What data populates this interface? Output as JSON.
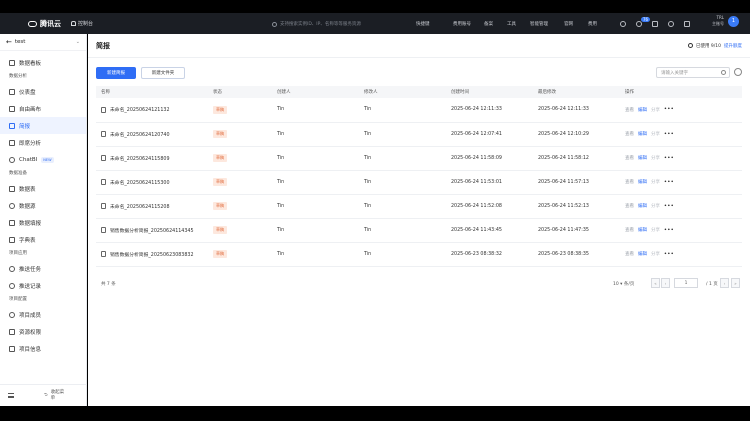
{
  "app": {
    "brand": "腾讯云",
    "workspace": "控制台",
    "search_placeholder": "支持搜索实例ID、IP、名称等等服务资源",
    "nav": [
      "快捷键",
      "费用账号",
      "备案",
      "工具",
      "智能管理",
      "官网",
      "费用"
    ],
    "notif_count": "76",
    "user_line1": "TRL",
    "user_line2": "主账号",
    "avatar": "1"
  },
  "sidebar": {
    "back_label": "test",
    "items_top": [
      {
        "label": "数据看板"
      }
    ],
    "groups": [
      {
        "title": "数据分析",
        "items": [
          {
            "label": "仪表盘",
            "active": false
          },
          {
            "label": "自由画布",
            "active": false
          },
          {
            "label": "简报",
            "active": true
          },
          {
            "label": "即席分析",
            "active": false
          },
          {
            "label": "ChatBI",
            "tag": "NEW",
            "active": false
          }
        ]
      },
      {
        "title": "数据准备",
        "items": [
          {
            "label": "数据表",
            "active": false
          },
          {
            "label": "数据源",
            "active": false
          },
          {
            "label": "数据填报",
            "active": false
          },
          {
            "label": "字典表",
            "active": false
          }
        ]
      },
      {
        "title": "项目应用",
        "items": [
          {
            "label": "推送任务",
            "active": false
          },
          {
            "label": "推送记录",
            "active": false
          }
        ]
      },
      {
        "title": "项目配置",
        "items": [
          {
            "label": "项目成员",
            "active": false
          },
          {
            "label": "资源权限",
            "active": false
          },
          {
            "label": "项目信息",
            "active": false
          }
        ]
      }
    ],
    "collapse_label": "收起菜单"
  },
  "main": {
    "title": "简报",
    "usage_text": "已使用 9/10",
    "usage_link": "提升额度",
    "new_button": "新建简报",
    "new_folder_button": "新建文件夹",
    "keyword_placeholder": "请输入关键字",
    "columns": [
      "名称",
      "状态",
      "创建人",
      "修改人",
      "创建时间",
      "最后修改",
      "操作"
    ],
    "rows": [
      {
        "name": "未命名_20250624121132",
        "status": "草稿",
        "creator": "Tin",
        "modifier": "Tin",
        "created": "2025-06-24 12:11:33",
        "modified": "2025-06-24 12:11:33"
      },
      {
        "name": "未命名_20250624120740",
        "status": "草稿",
        "creator": "Tin",
        "modifier": "Tin",
        "created": "2025-06-24 12:07:41",
        "modified": "2025-06-24 12:10:29"
      },
      {
        "name": "未命名_20250624115809",
        "status": "草稿",
        "creator": "Tin",
        "modifier": "Tin",
        "created": "2025-06-24 11:58:09",
        "modified": "2025-06-24 11:58:12"
      },
      {
        "name": "未命名_20250624115300",
        "status": "草稿",
        "creator": "Tin",
        "modifier": "Tin",
        "created": "2025-06-24 11:53:01",
        "modified": "2025-06-24 11:57:13"
      },
      {
        "name": "未命名_20250624115208",
        "status": "草稿",
        "creator": "Tin",
        "modifier": "Tin",
        "created": "2025-06-24 11:52:08",
        "modified": "2025-06-24 11:52:13"
      },
      {
        "name": "销售数据分析简报_20250624114345",
        "status": "草稿",
        "creator": "Tin",
        "modifier": "Tin",
        "created": "2025-06-24 11:43:45",
        "modified": "2025-06-24 11:47:35"
      },
      {
        "name": "销售数据分析简报_20250623083832",
        "status": "草稿",
        "creator": "Tin",
        "modifier": "Tin",
        "created": "2025-06-23 08:38:32",
        "modified": "2025-06-23 08:38:35"
      }
    ],
    "ops": {
      "view": "查看",
      "edit": "编辑",
      "share": "分享",
      "more": "•••"
    },
    "pager": {
      "total": "共 7 条",
      "page_size": "10 ▾ 条/页",
      "prev2": "«",
      "prev": "‹",
      "current": "1",
      "pages": "/ 1 页",
      "next": "›",
      "next2": "»"
    }
  }
}
